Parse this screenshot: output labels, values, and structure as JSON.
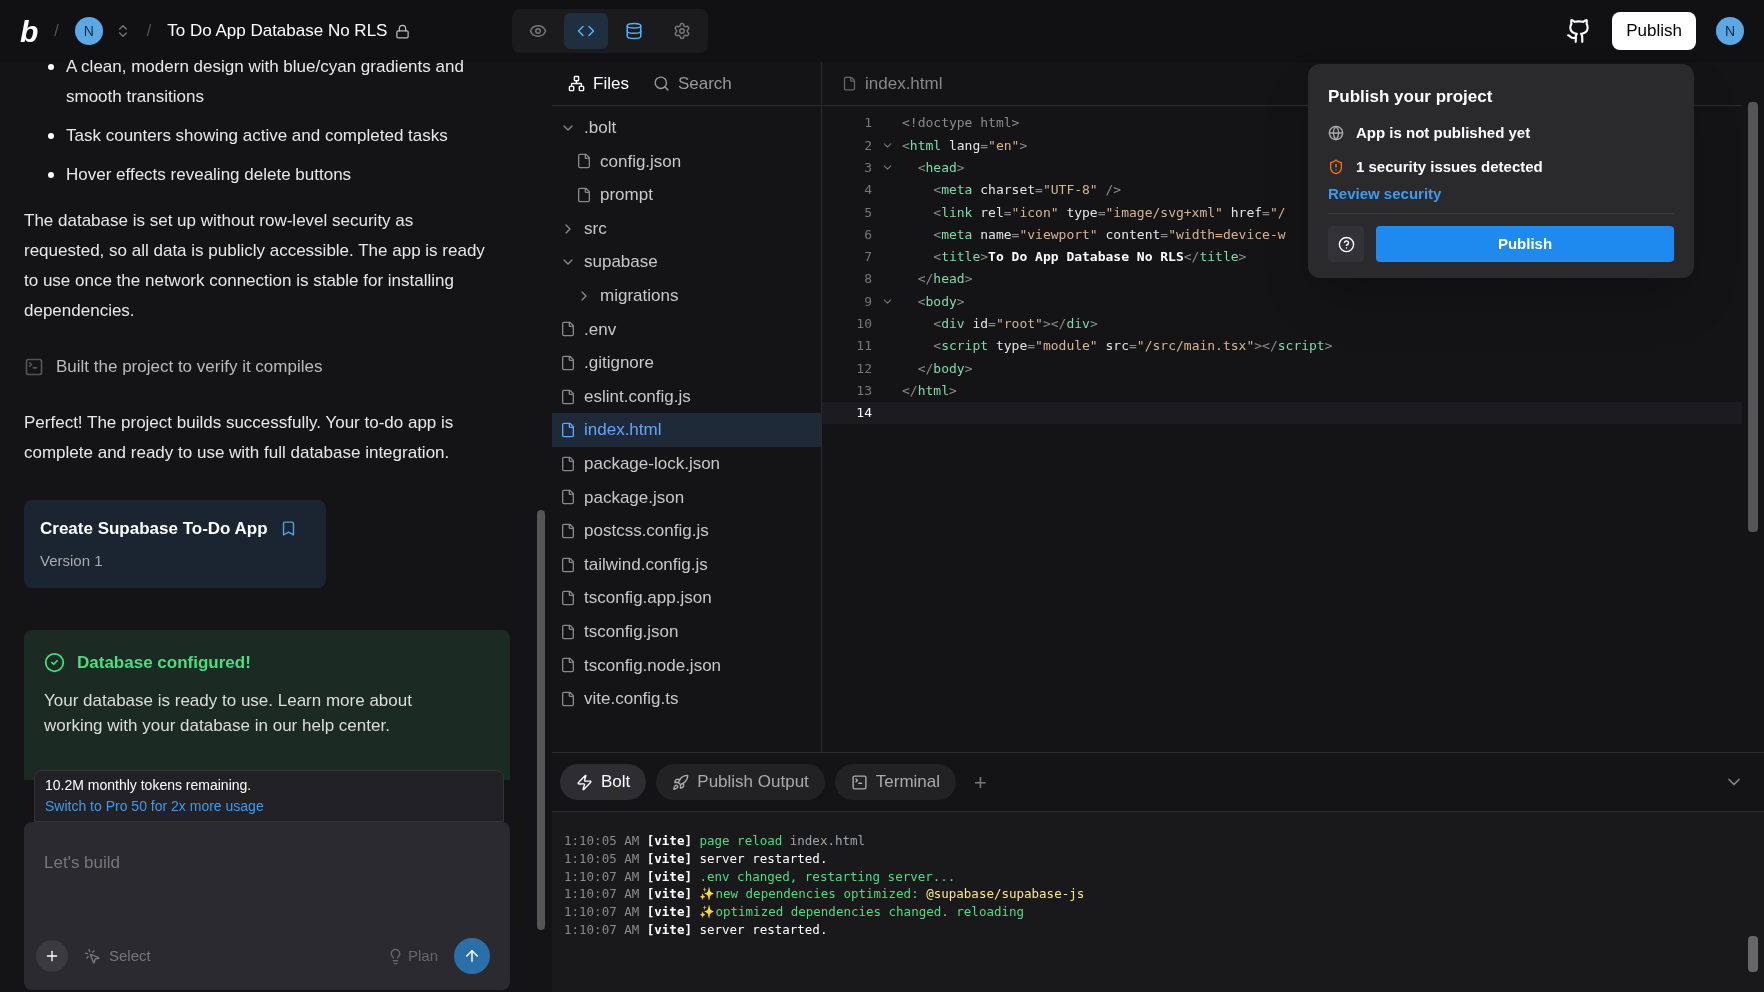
{
  "topbar": {
    "logo": "b",
    "separators": [
      "/",
      "/"
    ],
    "avatar": "N",
    "project_title": "To Do App Database No RLS",
    "views": [
      {
        "selected": false,
        "highlighted": false
      },
      {
        "selected": true,
        "highlighted": true
      },
      {
        "selected": false,
        "highlighted": true
      },
      {
        "selected": false,
        "highlighted": false
      }
    ],
    "publish": "Publish",
    "user_avatar": "N"
  },
  "chat": {
    "bullets": [
      "A clean, modern design with blue/cyan gradients and smooth transitions",
      "Task counters showing active and completed tasks",
      "Hover effects revealing delete buttons"
    ],
    "paragraph_1": "The database is set up without row-level security as requested, so all data is publicly accessible. The app is ready to use once the network connection is stable for installing dependencies.",
    "step": "Built the project to verify it compiles",
    "paragraph_2": "Perfect! The project builds successfully. Your to-do app is complete and ready to use with full database integration.",
    "version_card": {
      "title": "Create Supabase To-Do App",
      "version": "Version 1"
    },
    "db_card": {
      "title": "Database configured!",
      "body": "Your database is ready to use. Learn more about working with your database in our help center."
    },
    "tokens": {
      "text": "10.2M monthly tokens remaining.",
      "link": "Switch to Pro 50 for 2x more usage"
    },
    "input": {
      "placeholder": "Let's build",
      "select": "Select",
      "plan": "Plan"
    }
  },
  "files": {
    "tabs": [
      {
        "label": "Files",
        "selected": true
      },
      {
        "label": "Search",
        "selected": false
      }
    ],
    "tree": [
      {
        "kind": "folder",
        "name": ".bolt",
        "expanded": true,
        "selected": false,
        "children": [
          {
            "kind": "file",
            "name": "config.json",
            "selected": false
          },
          {
            "kind": "file",
            "name": "prompt",
            "selected": false
          }
        ]
      },
      {
        "kind": "folder",
        "name": "src",
        "expanded": false,
        "selected": false
      },
      {
        "kind": "folder",
        "name": "supabase",
        "expanded": true,
        "selected": false,
        "children": [
          {
            "kind": "folder",
            "name": "migrations",
            "expanded": false,
            "selected": false
          }
        ]
      },
      {
        "kind": "file",
        "name": ".env",
        "selected": false
      },
      {
        "kind": "file",
        "name": ".gitignore",
        "selected": false
      },
      {
        "kind": "file",
        "name": "eslint.config.js",
        "selected": false
      },
      {
        "kind": "file",
        "name": "index.html",
        "selected": true
      },
      {
        "kind": "file",
        "name": "package-lock.json",
        "selected": false
      },
      {
        "kind": "file",
        "name": "package.json",
        "selected": false
      },
      {
        "kind": "file",
        "name": "postcss.config.js",
        "selected": false
      },
      {
        "kind": "file",
        "name": "tailwind.config.js",
        "selected": false
      },
      {
        "kind": "file",
        "name": "tsconfig.app.json",
        "selected": false
      },
      {
        "kind": "file",
        "name": "tsconfig.json",
        "selected": false
      },
      {
        "kind": "file",
        "name": "tsconfig.node.json",
        "selected": false
      },
      {
        "kind": "file",
        "name": "vite.config.ts",
        "selected": false
      }
    ]
  },
  "editor": {
    "tab": "index.html",
    "lines": [
      {
        "n": "1",
        "fold": false,
        "current": false,
        "tokens": [
          {
            "kind": "punct",
            "t": "<!doctype html>"
          }
        ]
      },
      {
        "n": "2",
        "fold": true,
        "current": false,
        "tokens": [
          {
            "kind": "punct",
            "t": "<"
          },
          {
            "kind": "tag",
            "t": "html"
          },
          {
            "kind": "attr",
            "t": " lang"
          },
          {
            "kind": "punct",
            "t": "="
          },
          {
            "kind": "str",
            "t": "\"en\""
          },
          {
            "kind": "punct",
            "t": ">"
          }
        ]
      },
      {
        "n": "3",
        "fold": true,
        "current": false,
        "tokens": [
          {
            "kind": "punct",
            "t": "  <"
          },
          {
            "kind": "tag",
            "t": "head"
          },
          {
            "kind": "punct",
            "t": ">"
          }
        ]
      },
      {
        "n": "4",
        "fold": false,
        "current": false,
        "tokens": [
          {
            "kind": "punct",
            "t": "    <"
          },
          {
            "kind": "tag",
            "t": "meta"
          },
          {
            "kind": "attr",
            "t": " charset"
          },
          {
            "kind": "punct",
            "t": "="
          },
          {
            "kind": "str",
            "t": "\"UTF-8\""
          },
          {
            "kind": "punct",
            "t": " />"
          }
        ]
      },
      {
        "n": "5",
        "fold": false,
        "current": false,
        "tokens": [
          {
            "kind": "punct",
            "t": "    <"
          },
          {
            "kind": "tag",
            "t": "link"
          },
          {
            "kind": "attr",
            "t": " rel"
          },
          {
            "kind": "punct",
            "t": "="
          },
          {
            "kind": "str",
            "t": "\"icon\""
          },
          {
            "kind": "attr",
            "t": " type"
          },
          {
            "kind": "punct",
            "t": "="
          },
          {
            "kind": "str",
            "t": "\"image/svg+xml\""
          },
          {
            "kind": "attr",
            "t": " href"
          },
          {
            "kind": "punct",
            "t": "="
          },
          {
            "kind": "str",
            "t": "\"/"
          }
        ]
      },
      {
        "n": "6",
        "fold": false,
        "current": false,
        "tokens": [
          {
            "kind": "punct",
            "t": "    <"
          },
          {
            "kind": "tag",
            "t": "meta"
          },
          {
            "kind": "attr",
            "t": " name"
          },
          {
            "kind": "punct",
            "t": "="
          },
          {
            "kind": "str",
            "t": "\"viewport\""
          },
          {
            "kind": "attr",
            "t": " content"
          },
          {
            "kind": "punct",
            "t": "="
          },
          {
            "kind": "str",
            "t": "\"width=device-w"
          }
        ]
      },
      {
        "n": "7",
        "fold": false,
        "current": false,
        "tokens": [
          {
            "kind": "punct",
            "t": "    <"
          },
          {
            "kind": "tag",
            "t": "title"
          },
          {
            "kind": "punct",
            "t": ">"
          },
          {
            "kind": "text",
            "t": "To Do App Database No RLS"
          },
          {
            "kind": "punct",
            "t": "</"
          },
          {
            "kind": "tag",
            "t": "title"
          },
          {
            "kind": "punct",
            "t": ">"
          }
        ]
      },
      {
        "n": "8",
        "fold": false,
        "current": false,
        "tokens": [
          {
            "kind": "punct",
            "t": "  </"
          },
          {
            "kind": "tag",
            "t": "head"
          },
          {
            "kind": "punct",
            "t": ">"
          }
        ]
      },
      {
        "n": "9",
        "fold": true,
        "current": false,
        "tokens": [
          {
            "kind": "punct",
            "t": "  <"
          },
          {
            "kind": "tag",
            "t": "body"
          },
          {
            "kind": "punct",
            "t": ">"
          }
        ]
      },
      {
        "n": "10",
        "fold": false,
        "current": false,
        "tokens": [
          {
            "kind": "punct",
            "t": "    <"
          },
          {
            "kind": "tag",
            "t": "div"
          },
          {
            "kind": "attr",
            "t": " id"
          },
          {
            "kind": "punct",
            "t": "="
          },
          {
            "kind": "str",
            "t": "\"root\""
          },
          {
            "kind": "punct",
            "t": "></"
          },
          {
            "kind": "tag",
            "t": "div"
          },
          {
            "kind": "punct",
            "t": ">"
          }
        ]
      },
      {
        "n": "11",
        "fold": false,
        "current": false,
        "tokens": [
          {
            "kind": "punct",
            "t": "    <"
          },
          {
            "kind": "tag",
            "t": "script"
          },
          {
            "kind": "attr",
            "t": " type"
          },
          {
            "kind": "punct",
            "t": "="
          },
          {
            "kind": "str",
            "t": "\"module\""
          },
          {
            "kind": "attr",
            "t": " src"
          },
          {
            "kind": "punct",
            "t": "="
          },
          {
            "kind": "str",
            "t": "\"/src/main.tsx\""
          },
          {
            "kind": "punct",
            "t": "></"
          },
          {
            "kind": "tag",
            "t": "script"
          },
          {
            "kind": "punct",
            "t": ">"
          }
        ]
      },
      {
        "n": "12",
        "fold": false,
        "current": false,
        "tokens": [
          {
            "kind": "punct",
            "t": "  </"
          },
          {
            "kind": "tag",
            "t": "body"
          },
          {
            "kind": "punct",
            "t": ">"
          }
        ]
      },
      {
        "n": "13",
        "fold": false,
        "current": false,
        "tokens": [
          {
            "kind": "punct",
            "t": "</"
          },
          {
            "kind": "tag",
            "t": "html"
          },
          {
            "kind": "punct",
            "t": ">"
          }
        ]
      },
      {
        "n": "14",
        "fold": false,
        "current": true
      }
    ]
  },
  "popup": {
    "title": "Publish your project",
    "status": "App is not published yet",
    "issues": "1 security issues detected",
    "link": "Review security",
    "publish": "Publish"
  },
  "bottom": {
    "tabs": [
      {
        "label": "Bolt",
        "selected": true
      },
      {
        "label": "Publish Output",
        "selected": false
      },
      {
        "label": "Terminal",
        "selected": false
      }
    ],
    "add": "+",
    "log": [
      [
        {
          "kind": "time",
          "t": "1:10:05 AM"
        },
        {
          "kind": "tag",
          "t": "[vite]"
        },
        {
          "kind": "ok",
          "t": "page reload"
        },
        {
          "kind": "dim",
          "t": "index.html"
        }
      ],
      [
        {
          "kind": "time",
          "t": "1:10:05 AM"
        },
        {
          "kind": "tag",
          "t": "[vite]"
        },
        {
          "kind": "plain",
          "t": "server restarted."
        }
      ],
      [
        {
          "kind": "time",
          "t": "1:10:07 AM"
        },
        {
          "kind": "tag",
          "t": "[vite]"
        },
        {
          "kind": "ok",
          "t": ".env changed, restarting server..."
        }
      ],
      [
        {
          "kind": "time",
          "t": "1:10:07 AM"
        },
        {
          "kind": "tag",
          "t": "[vite]"
        },
        {
          "kind": "ok",
          "t": "✨new dependencies optimized:"
        },
        {
          "kind": "pkg",
          "t": "@supabase/supabase-js"
        }
      ],
      [
        {
          "kind": "time",
          "t": "1:10:07 AM"
        },
        {
          "kind": "tag",
          "t": "[vite]"
        },
        {
          "kind": "ok",
          "t": "✨optimized dependencies changed. reloading"
        }
      ],
      [
        {
          "kind": "time",
          "t": "1:10:07 AM"
        },
        {
          "kind": "tag",
          "t": "[vite]"
        },
        {
          "kind": "plain",
          "t": "server restarted."
        }
      ]
    ]
  }
}
